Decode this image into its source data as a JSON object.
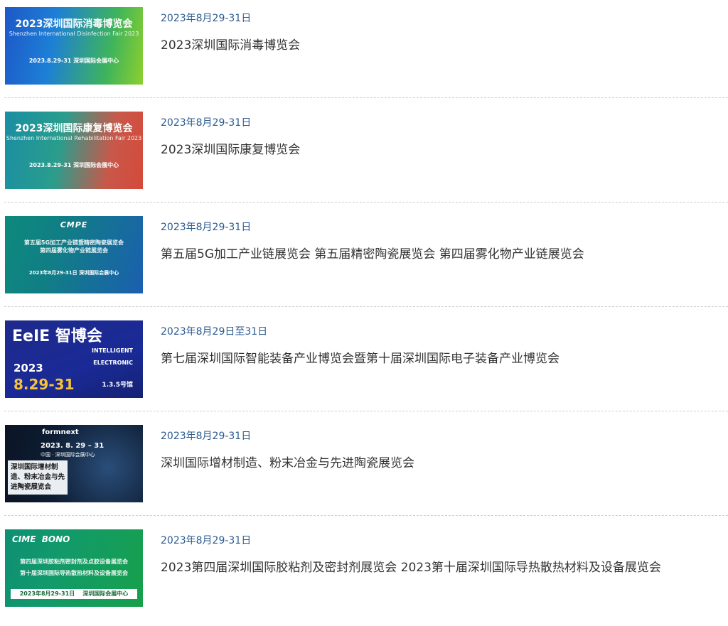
{
  "items": [
    {
      "date": "2023年8月29-31日",
      "title": "2023深圳国际消毒博览会",
      "thumb": {
        "title": "2023深圳国际消毒博览会",
        "subtitle": "Shenzhen International Disinfection Fair 2023",
        "footer": "2023.8.29-31     深圳国际会展中心"
      }
    },
    {
      "date": "2023年8月29-31日",
      "title": "2023深圳国际康复博览会",
      "thumb": {
        "title": "2023深圳国际康复博览会",
        "subtitle": "Shenzhen International Rehabilitation Fair 2023",
        "footer": "2023.8.29-31     深圳国际会展中心"
      }
    },
    {
      "date": "2023年8月29-31日",
      "title": "第五届5G加工产业链展览会 第五届精密陶瓷展览会 第四届雾化物产业链展览会",
      "thumb": {
        "logo": "CMPE",
        "line1": "第五届5G加工产业链暨精密陶瓷展览会",
        "line2": "第四届雾化物产业链展览会",
        "footer": "2023年8月29-31日  深圳国际会展中心"
      }
    },
    {
      "date": "2023年8月29日至31日",
      "title": "第七届深圳国际智能装备产业博览会暨第十届深圳国际电子装备产业博览会",
      "thumb": {
        "logo": "EeIE 智博会",
        "line1": "INTELLIGENT",
        "line2": "ELECTRONIC",
        "year": "2023",
        "dates": "8.29-31",
        "hall": "1.3.5号馆"
      }
    },
    {
      "date": "2023年8月29-31日",
      "title": "深圳国际增材制造、粉末冶金与先进陶瓷展览会",
      "thumb": {
        "logo": "formnext",
        "dates": "2023. 8. 29 – 31",
        "venue": "中国 · 深圳国际会展中心",
        "box": "深圳国际增材制造、粉末冶金与先进陶瓷展览会"
      }
    },
    {
      "date": "2023年8月29-31日",
      "title": "2023第四届深圳国际胶粘剂及密封剂展览会 2023第十届深圳国际导热散热材料及设备展览会",
      "thumb": {
        "logo": "CIME  BONO",
        "line1": "第四届深圳胶粘剂密封剂及点胶设备展览会",
        "line2": "第十届深圳国际导热散热材料及设备展览会",
        "footer": "2023年8月29-31日    深圳国际会展中心"
      }
    }
  ]
}
